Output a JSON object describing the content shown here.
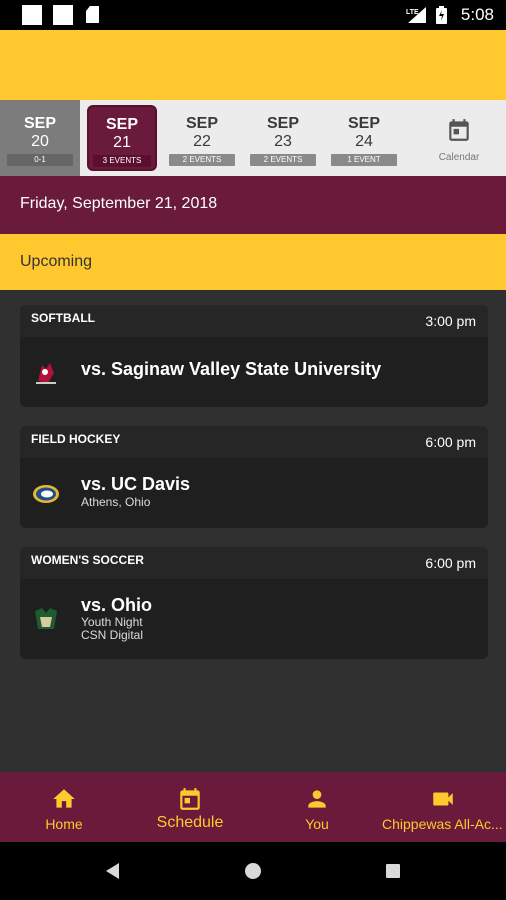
{
  "status_bar": {
    "time": "5:08",
    "network": "LTE"
  },
  "date_strip": {
    "dates": [
      {
        "month": "SEP",
        "day": "20",
        "badge": "0-1"
      },
      {
        "month": "SEP",
        "day": "21",
        "badge": "3 EVENTS"
      },
      {
        "month": "SEP",
        "day": "22",
        "badge": "2 EVENTS"
      },
      {
        "month": "SEP",
        "day": "23",
        "badge": "2 EVENTS"
      },
      {
        "month": "SEP",
        "day": "24",
        "badge": "1 EVENT"
      }
    ],
    "calendar_label": "Calendar"
  },
  "day_header": "Friday, September 21, 2018",
  "section_label": "Upcoming",
  "events": [
    {
      "sport": "SOFTBALL",
      "time": "3:00 pm",
      "opponent": "vs. Saginaw Valley State University",
      "details": []
    },
    {
      "sport": "FIELD HOCKEY",
      "time": "6:00 pm",
      "opponent": "vs. UC Davis",
      "details": [
        "Athens, Ohio"
      ]
    },
    {
      "sport": "WOMEN'S SOCCER",
      "time": "6:00 pm",
      "opponent": "vs. Ohio",
      "details": [
        "Youth Night",
        "CSN Digital"
      ]
    }
  ],
  "bottom_nav": [
    {
      "label": "Home",
      "icon": "home-icon"
    },
    {
      "label": "Schedule",
      "icon": "calendar-icon"
    },
    {
      "label": "You",
      "icon": "person-icon"
    },
    {
      "label": "Chippewas All-Ac...",
      "icon": "video-icon"
    }
  ],
  "colors": {
    "gold": "#ffc82e",
    "maroon": "#6a1a3a",
    "background": "#303030"
  }
}
